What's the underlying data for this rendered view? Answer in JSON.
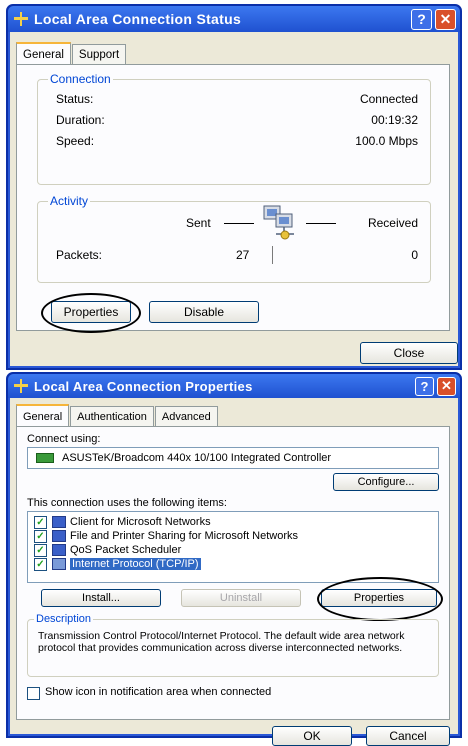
{
  "status_window": {
    "title": "Local Area Connection Status",
    "tabs": [
      "General",
      "Support"
    ],
    "connection": {
      "group_title": "Connection",
      "rows": [
        {
          "label": "Status:",
          "value": "Connected"
        },
        {
          "label": "Duration:",
          "value": "00:19:32"
        },
        {
          "label": "Speed:",
          "value": "100.0 Mbps"
        }
      ]
    },
    "activity": {
      "group_title": "Activity",
      "sent_label": "Sent",
      "received_label": "Received",
      "packets_label": "Packets:",
      "packets_sent": "27",
      "packets_received": "0"
    },
    "properties_button": "Properties",
    "disable_button": "Disable",
    "close_button": "Close"
  },
  "properties_window": {
    "title": "Local Area Connection Properties",
    "tabs": [
      "General",
      "Authentication",
      "Advanced"
    ],
    "connect_using_label": "Connect using:",
    "adapter_name": "ASUSTeK/Broadcom 440x 10/100 Integrated Controller",
    "configure_button": "Configure...",
    "items_label": "This connection uses the following items:",
    "items": [
      {
        "label": "Client for Microsoft Networks",
        "checked": true
      },
      {
        "label": "File and Printer Sharing for Microsoft Networks",
        "checked": true
      },
      {
        "label": "QoS Packet Scheduler",
        "checked": true
      },
      {
        "label": "Internet Protocol (TCP/IP)",
        "checked": true,
        "selected": true
      }
    ],
    "install_button": "Install...",
    "uninstall_button": "Uninstall",
    "properties_button": "Properties",
    "description_title": "Description",
    "description_text": "Transmission Control Protocol/Internet Protocol. The default wide area network protocol that provides communication across diverse interconnected networks.",
    "show_icon_label": "Show icon in notification area when connected",
    "ok_button": "OK",
    "cancel_button": "Cancel"
  }
}
